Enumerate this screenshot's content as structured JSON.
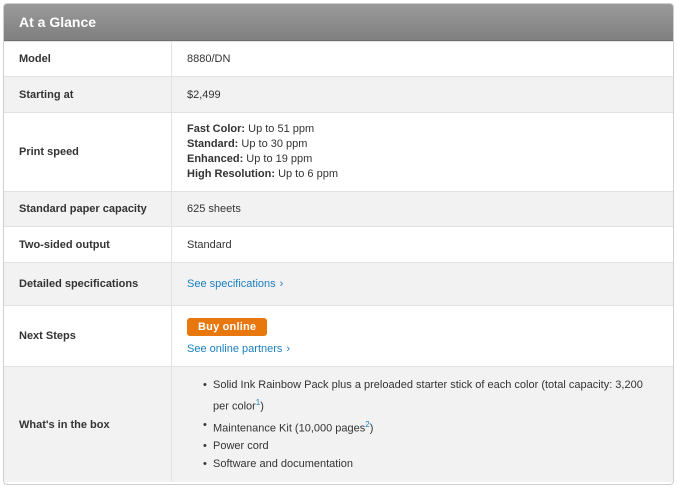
{
  "header": {
    "title": "At a Glance"
  },
  "rows": {
    "model": {
      "label": "Model",
      "value": "8880/DN"
    },
    "starting": {
      "label": "Starting at",
      "value": "$2,499"
    },
    "print_speed": {
      "label": "Print speed",
      "lines": [
        {
          "mode": "Fast Color:",
          "speed": "Up to 51 ppm"
        },
        {
          "mode": "Standard:",
          "speed": "Up to 30 ppm"
        },
        {
          "mode": "Enhanced:",
          "speed": "Up to 19 ppm"
        },
        {
          "mode": "High Resolution:",
          "speed": "Up to 6 ppm"
        }
      ]
    },
    "paper": {
      "label": "Standard paper capacity",
      "value": "625 sheets"
    },
    "two_sided": {
      "label": "Two-sided output",
      "value": "Standard"
    },
    "specs": {
      "label": "Detailed specifications",
      "link": "See specifications"
    },
    "next_steps": {
      "label": "Next Steps",
      "button": "Buy online",
      "link": "See online partners"
    },
    "box": {
      "label": "What's in the box",
      "items": [
        {
          "text_a": "Solid Ink Rainbow Pack plus a preloaded starter stick of each color (total capacity: 3,200",
          "text_b": "per color",
          "sup": "1",
          "text_c": ")"
        },
        {
          "text_a": "Maintenance Kit (10,000 pages",
          "sup": "2",
          "text_c": ")"
        },
        {
          "text_a": "Power cord"
        },
        {
          "text_a": "Software and documentation"
        }
      ]
    }
  },
  "icons": {
    "link_chevron": "chevron-right-icon"
  },
  "colors": {
    "accent": "#e8770d",
    "link": "#1a7fbf",
    "header_bg": "#8a8a8a"
  }
}
